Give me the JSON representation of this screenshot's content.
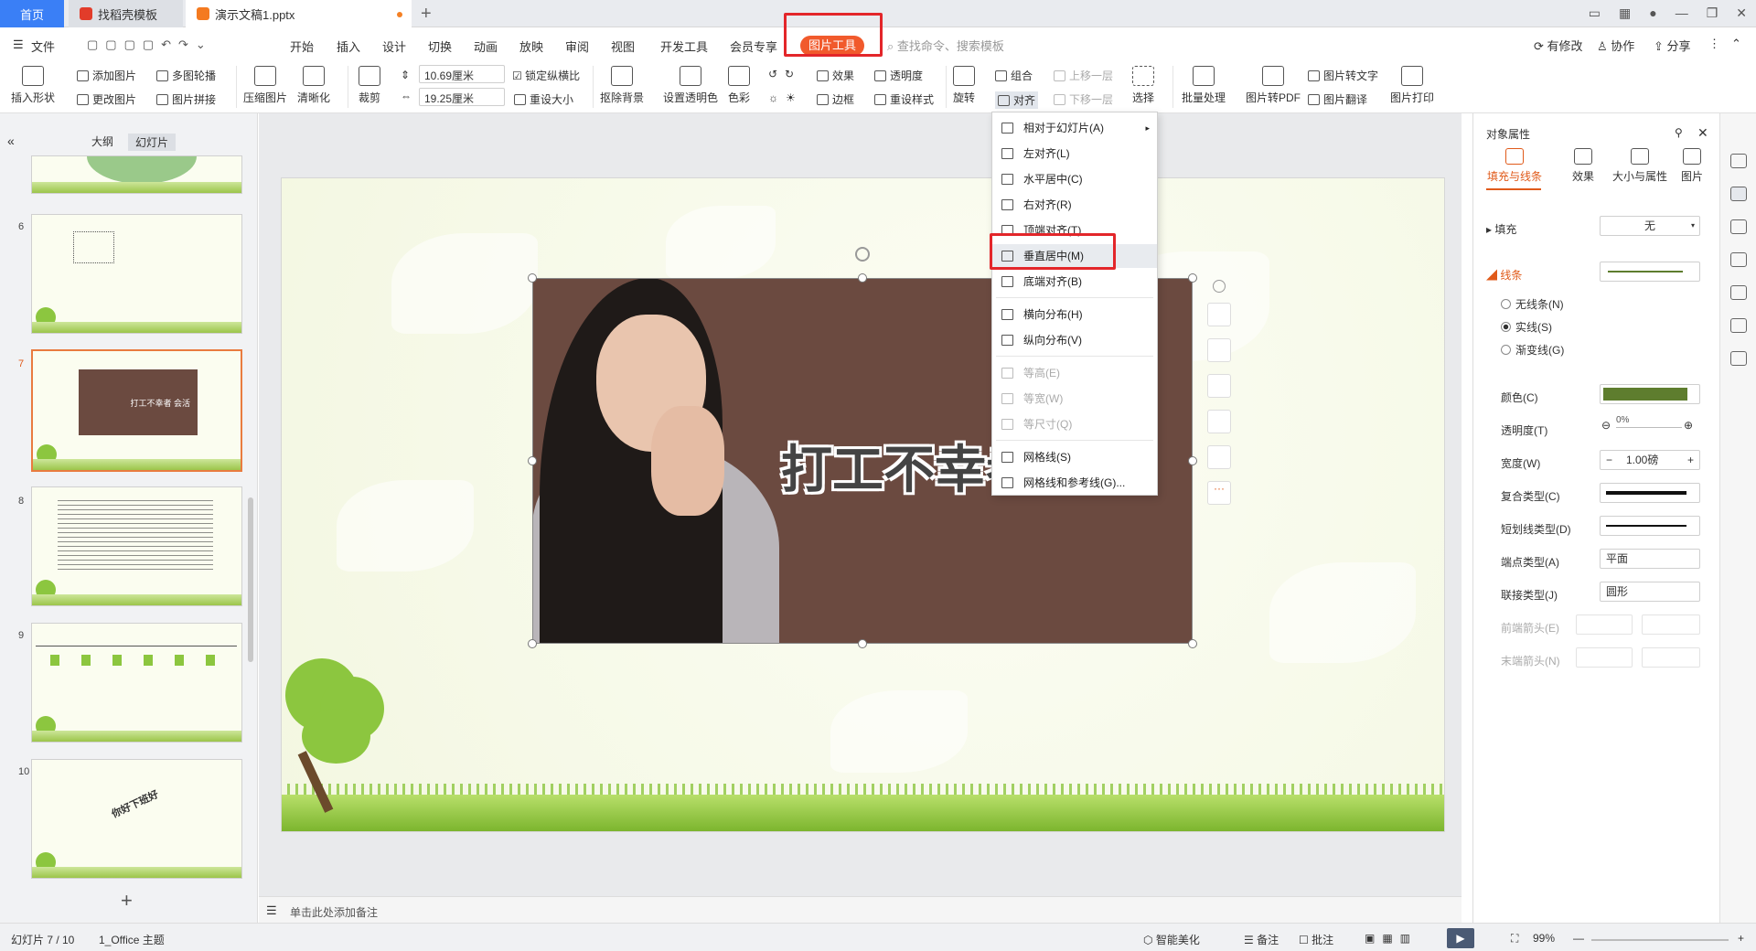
{
  "tabs": {
    "home": "首页",
    "template": "找稻壳模板",
    "doc": "演示文稿1.pptx",
    "new": "+"
  },
  "menu": {
    "file": "文件",
    "items": [
      "开始",
      "插入",
      "设计",
      "切换",
      "动画",
      "放映",
      "审阅",
      "视图",
      "开发工具",
      "会员专享"
    ],
    "picture_tools": "图片工具",
    "search": "查找命令、搜索模板",
    "modified": "有修改",
    "collab": "协作",
    "share": "分享"
  },
  "ribbon": {
    "insert_shape": "插入形状",
    "add_pic": "添加图片",
    "multi_outline": "多图轮播",
    "change_pic": "更改图片",
    "pic_splice": "图片拼接",
    "compress": "压缩图片",
    "clarify": "清晰化",
    "crop": "裁剪",
    "width": "10.69厘米",
    "height": "19.25厘米",
    "lock_ratio": "锁定纵横比",
    "reset_size": "重设大小",
    "cutout": "抠除背景",
    "set_transparent": "设置透明色",
    "color": "色彩",
    "effect": "效果",
    "transparency": "透明度",
    "border": "边框",
    "reset_style": "重设样式",
    "rotate": "旋转",
    "group": "组合",
    "align": "对齐",
    "up_layer": "上移一层",
    "down_layer": "下移一层",
    "select": "选择",
    "batch": "批量处理",
    "to_pdf": "图片转PDF",
    "to_text": "图片转文字",
    "translate": "图片翻译",
    "print": "图片打印"
  },
  "left_panel": {
    "outline": "大纲",
    "slides": "幻灯片",
    "slide_numbers": [
      "6",
      "7",
      "8",
      "9",
      "10"
    ],
    "thumb7_text": "打工不幸者 会活",
    "thumb10_text": "你好下班好",
    "add": "+"
  },
  "slide": {
    "picture_text": "打工不幸者"
  },
  "align_menu": {
    "items": [
      {
        "label": "相对于幻灯片(A)",
        "disabled": false
      },
      {
        "label": "左对齐(L)",
        "disabled": false
      },
      {
        "label": "水平居中(C)",
        "disabled": false
      },
      {
        "label": "右对齐(R)",
        "disabled": false
      },
      {
        "label": "顶端对齐(T)",
        "disabled": false
      },
      {
        "label": "垂直居中(M)",
        "disabled": false
      },
      {
        "label": "底端对齐(B)",
        "disabled": false
      },
      {
        "label": "横向分布(H)",
        "disabled": false
      },
      {
        "label": "纵向分布(V)",
        "disabled": false
      },
      {
        "label": "等高(E)",
        "disabled": true
      },
      {
        "label": "等宽(W)",
        "disabled": true
      },
      {
        "label": "等尺寸(Q)",
        "disabled": true
      },
      {
        "label": "网格线(S)",
        "disabled": false
      },
      {
        "label": "网格线和参考线(G)...",
        "disabled": false
      }
    ],
    "highlighted": "垂直居中(M)"
  },
  "right_panel": {
    "title": "对象属性",
    "tabs": [
      "填充与线条",
      "效果",
      "大小与属性",
      "图片"
    ],
    "fill": "填充",
    "fill_value": "无",
    "line": "线条",
    "no_line": "无线条(N)",
    "solid": "实线(S)",
    "gradient": "渐变线(G)",
    "color": "颜色(C)",
    "transparency": "透明度(T)",
    "transparency_value": "0%",
    "width": "宽度(W)",
    "width_value": "1.00磅",
    "compound": "复合类型(C)",
    "dash": "短划线类型(D)",
    "cap": "端点类型(A)",
    "cap_value": "平面",
    "join": "联接类型(J)",
    "join_value": "圆形",
    "begin_arrow": "前端箭头(E)",
    "end_arrow": "末端箭头(N)",
    "line_color": "#5e7d2e"
  },
  "notes": {
    "placeholder": "单击此处添加备注"
  },
  "status": {
    "slide": "幻灯片 7 / 10",
    "theme": "1_Office 主题",
    "beautify": "智能美化",
    "notes": "备注",
    "comment": "批注",
    "zoom": "99%"
  }
}
